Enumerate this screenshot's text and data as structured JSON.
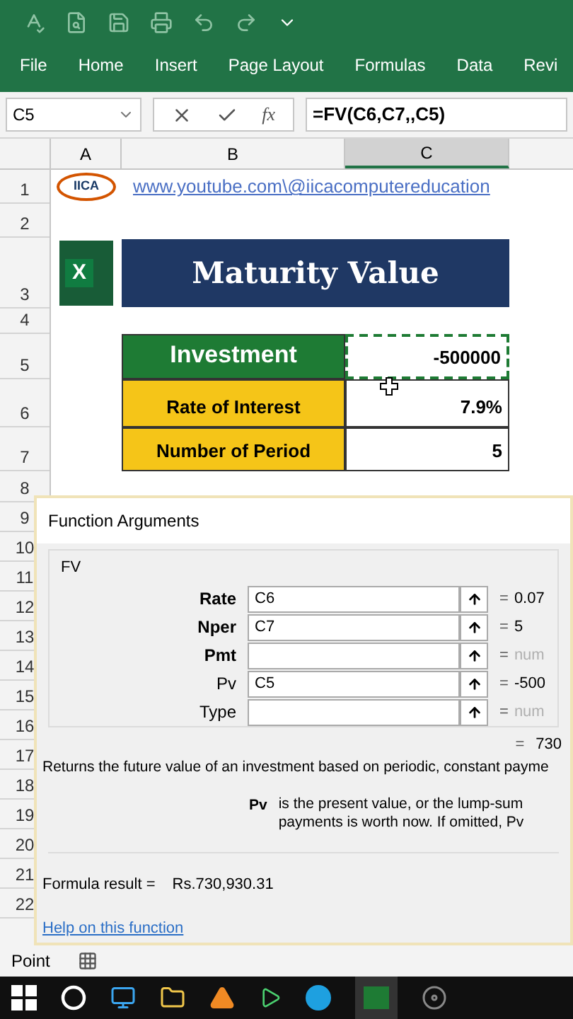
{
  "ribbon_tabs": [
    "File",
    "Home",
    "Insert",
    "Page Layout",
    "Formulas",
    "Data",
    "Revi"
  ],
  "formula_bar": {
    "name_box": "C5",
    "fx": "fx",
    "formula": "=FV(C6,C7,,C5)"
  },
  "columns": [
    {
      "label": "A",
      "selected": false
    },
    {
      "label": "B",
      "selected": false
    },
    {
      "label": "C",
      "selected": true
    }
  ],
  "row_numbers": [
    "1",
    "2",
    "3",
    "4",
    "5",
    "6",
    "7",
    "8",
    "9",
    "10",
    "11",
    "12",
    "13",
    "14",
    "15",
    "16",
    "17",
    "18",
    "19",
    "20",
    "21",
    "22"
  ],
  "sheet": {
    "link": "www.youtube.com\\@iicacomputereducation",
    "logo_text": "IICA",
    "excel_logo": "X",
    "title": "Maturity Value",
    "table": [
      {
        "label": "Investment",
        "value": "-500000",
        "kind": "header",
        "marquee": true
      },
      {
        "label": "Rate of Interest",
        "value": "7.9%",
        "kind": "input",
        "marquee": false
      },
      {
        "label": "Number of Period",
        "value": "5",
        "kind": "input",
        "marquee": false
      }
    ]
  },
  "dialog": {
    "title": "Function Arguments",
    "function": "FV",
    "arguments": [
      {
        "label": "Rate",
        "value": "C6",
        "result": "0.07",
        "required": true,
        "muted": false
      },
      {
        "label": "Nper",
        "value": "C7",
        "result": "5",
        "required": true,
        "muted": false
      },
      {
        "label": "Pmt",
        "result": "num",
        "required": true,
        "muted": true
      },
      {
        "label": "Pv",
        "value": "C5",
        "result": "-500",
        "required": false,
        "muted": false
      },
      {
        "label": "Type",
        "result": "num",
        "required": false,
        "muted": true
      }
    ],
    "equals": "=",
    "total": "730",
    "description": "Returns the future value of an investment based on periodic, constant payme",
    "arg_name": "Pv",
    "arg_help": [
      "is the present value, or the lump-sum",
      "payments is worth now. If omitted, Pv"
    ],
    "result_label": "Formula result =",
    "result_value": "Rs.730,930.31",
    "help_link": "Help on this function"
  },
  "status": "Point"
}
